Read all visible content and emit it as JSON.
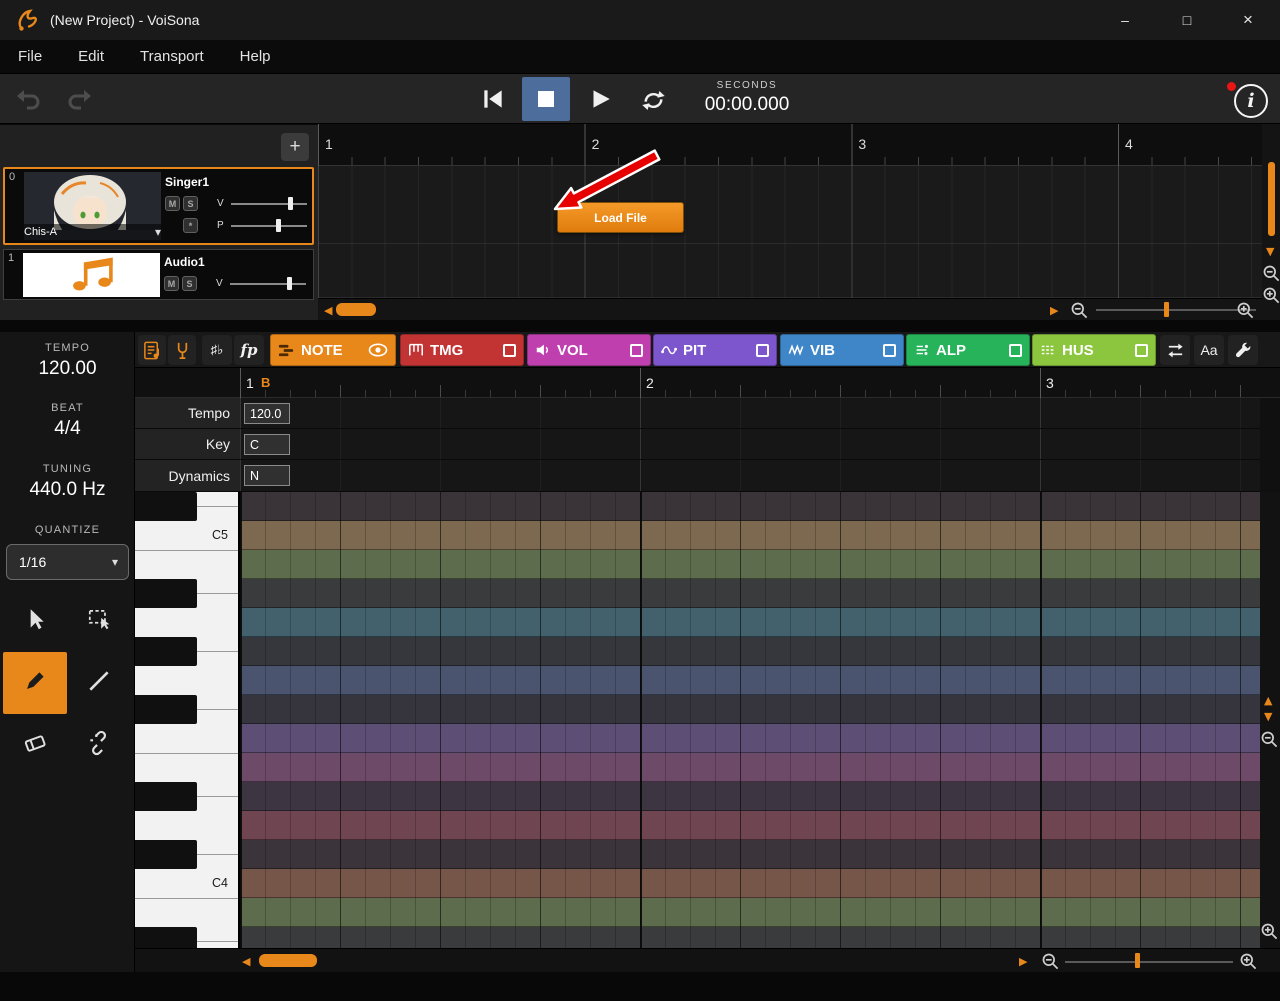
{
  "titlebar": {
    "title": "(New Project) - VoiSona",
    "minimize_glyph": "–",
    "maximize_glyph": "□",
    "close_glyph": "×"
  },
  "menu": {
    "items": [
      "File",
      "Edit",
      "Transport",
      "Help"
    ]
  },
  "transport": {
    "seconds_label": "SECONDS",
    "time": "00:00.000"
  },
  "track_panel": {
    "add_button": "+",
    "tracks": [
      {
        "index": "0",
        "name": "Singer1",
        "voice": "Chis-A",
        "mute": "M",
        "solo": "S",
        "volume_label": "V",
        "pitch_label": "P",
        "freeze_label": "*"
      },
      {
        "index": "1",
        "name": "Audio1",
        "mute": "M",
        "solo": "S",
        "volume_label": "V"
      }
    ]
  },
  "arrange": {
    "measures": [
      "1",
      "2",
      "3",
      "4"
    ],
    "load_file_button": "Load File"
  },
  "sidebar": {
    "tempo_label": "TEMPO",
    "tempo_value": "120.00",
    "beat_label": "BEAT",
    "beat_value": "4/4",
    "tuning_label": "TUNING",
    "tuning_value": "440.0 Hz",
    "quantize_label": "QUANTIZE",
    "quantize_value": "1/16",
    "tools": [
      {
        "id": "select"
      },
      {
        "id": "marquee"
      },
      {
        "id": "pencil",
        "selected": true
      },
      {
        "id": "line"
      },
      {
        "id": "eraser"
      },
      {
        "id": "unlink"
      }
    ]
  },
  "editor": {
    "accidentals_button": "♯♭",
    "dynamics_button": "fp",
    "text_button": "Aa",
    "tabs": [
      {
        "label": "NOTE",
        "color": "#e8871a",
        "icon": "note-roll-icon",
        "right": "eye"
      },
      {
        "label": "TMG",
        "color": "#c23434",
        "icon": "timing-icon",
        "right": "checkbox"
      },
      {
        "label": "VOL",
        "color": "#bf3fae",
        "icon": "volume-icon",
        "right": "checkbox"
      },
      {
        "label": "PIT",
        "color": "#7d55cc",
        "icon": "pitch-icon",
        "right": "checkbox"
      },
      {
        "label": "VIB",
        "color": "#3f86c9",
        "icon": "vibrato-icon",
        "right": "checkbox"
      },
      {
        "label": "ALP",
        "color": "#27b35a",
        "icon": "alp-icon",
        "right": "checkbox"
      },
      {
        "label": "HUS",
        "color": "#8cc63f",
        "icon": "hus-icon",
        "right": "checkbox"
      }
    ],
    "ruler": {
      "measures": [
        "1",
        "2",
        "3"
      ],
      "beat_marker": "B"
    },
    "meta_rows": [
      {
        "label": "Tempo",
        "value": "120.0"
      },
      {
        "label": "Key",
        "value": "C"
      },
      {
        "label": "Dynamics",
        "value": "N"
      }
    ],
    "pitch_rows": [
      {
        "pitch": "C#5",
        "key": "black",
        "color": "#3a3438"
      },
      {
        "pitch": "C5",
        "key": "white",
        "color": "#7c6950",
        "label": "C5"
      },
      {
        "pitch": "B4",
        "key": "white",
        "color": "#5d6c4c"
      },
      {
        "pitch": "A#4",
        "key": "black",
        "color": "#393b3d"
      },
      {
        "pitch": "A4",
        "key": "white",
        "color": "#42616c"
      },
      {
        "pitch": "G#4",
        "key": "black",
        "color": "#35373d"
      },
      {
        "pitch": "G4",
        "key": "white",
        "color": "#4a546f"
      },
      {
        "pitch": "F#4",
        "key": "black",
        "color": "#36353e"
      },
      {
        "pitch": "F4",
        "key": "white",
        "color": "#5d4e76"
      },
      {
        "pitch": "E4",
        "key": "white",
        "color": "#6d4a67"
      },
      {
        "pitch": "D#4",
        "key": "black",
        "color": "#3d3541"
      },
      {
        "pitch": "D4",
        "key": "white",
        "color": "#6f4551"
      },
      {
        "pitch": "C#4",
        "key": "black",
        "color": "#3b343a"
      },
      {
        "pitch": "C4",
        "key": "white",
        "color": "#77564a",
        "label": "C4"
      },
      {
        "pitch": "B3",
        "key": "white",
        "color": "#5d6c4c"
      },
      {
        "pitch": "A#3",
        "key": "black",
        "color": "#393b3d"
      }
    ]
  },
  "icons": {
    "chevron_down": "▾",
    "scroll_left": "◀",
    "scroll_right": "▶",
    "scroll_up": "▲",
    "scroll_down": "▼"
  },
  "colors": {
    "accent": "#e8871a",
    "stop_active": "#4d6d9d",
    "annotation_arrow": "#e60000"
  }
}
